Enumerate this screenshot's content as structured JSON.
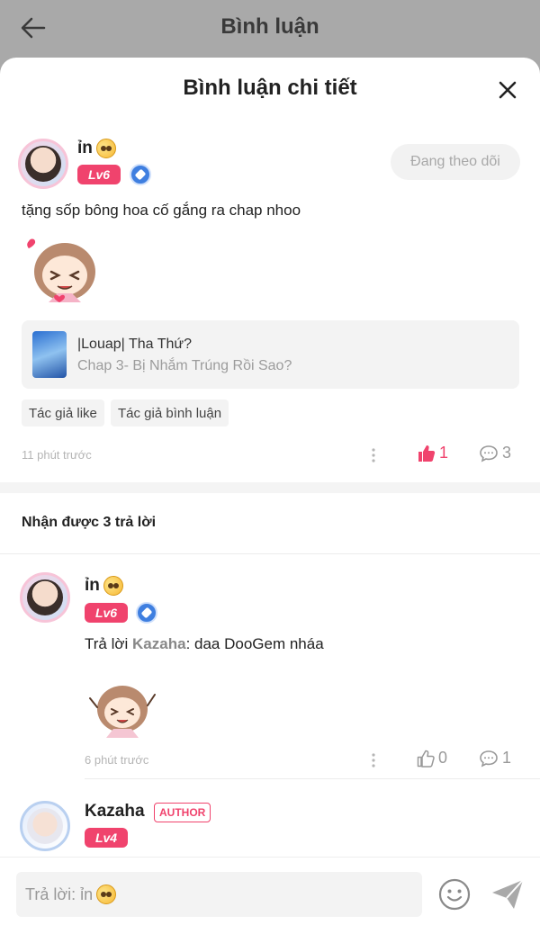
{
  "topbar": {
    "title": "Bình luận"
  },
  "sheet": {
    "title": "Bình luận chi tiết"
  },
  "main_comment": {
    "username": "ỉn",
    "level": "Lv6",
    "follow_label": "Đang theo dõi",
    "text": "tặng sốp bông hoa cố gắng ra chap nhoo",
    "chapter": {
      "title": "|Louap| Tha Thứ?",
      "subtitle": "Chap 3- Bị Nhắm Trúng Rồi Sao?"
    },
    "tags": [
      "Tác giả like",
      "Tác giả bình luận"
    ],
    "time": "11 phút trước",
    "likes": "1",
    "replies": "3"
  },
  "replies_header": "Nhận được 3 trả lời",
  "reply_1": {
    "username": "ỉn",
    "level": "Lv6",
    "reply_prefix": "Trả lời ",
    "reply_to": "Kazaha",
    "reply_text": ": daa DooGem nháa",
    "time": "6 phút trước",
    "likes": "0",
    "replies": "1"
  },
  "reply_2": {
    "username": "Kazaha",
    "author_label": "AUTHOR",
    "level": "Lv4"
  },
  "input": {
    "placeholder": "Trả lời: ỉn"
  },
  "colors": {
    "accent": "#f0436d",
    "gem": "#3f7fe0"
  }
}
